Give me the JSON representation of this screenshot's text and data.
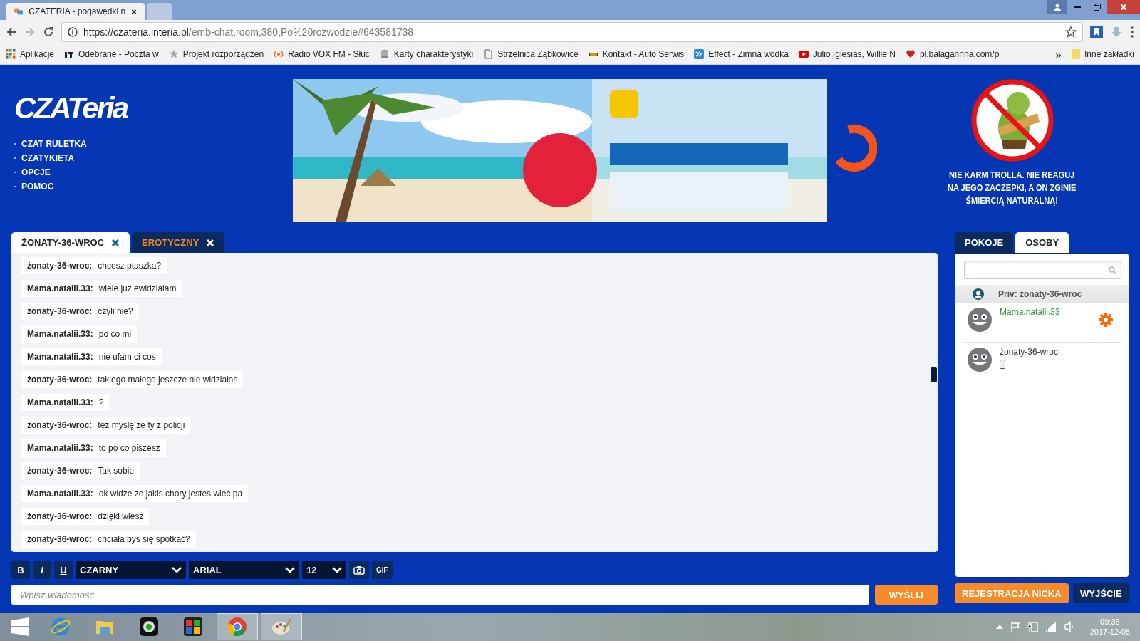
{
  "browser": {
    "tabs": [
      {
        "title": "CZATERIA - pogawędki n",
        "selected": true,
        "kind": "page"
      },
      {
        "selected": false,
        "kind": "new"
      }
    ],
    "url_host": "https://czateria.interia.pl",
    "url_path": "/emb-chat,room,380,Po%20rozwodzie#643581738",
    "bookmarks": [
      {
        "label": "Aplikacje",
        "kind": "apps"
      },
      {
        "label": "Odebrane - Poczta w",
        "kind": "int"
      },
      {
        "label": "Projekt rozporządzen",
        "kind": "eagle"
      },
      {
        "label": "Radio VOX FM - Słuc",
        "kind": "radio"
      },
      {
        "label": "Karty charakterystyki",
        "kind": "db"
      },
      {
        "label": "Strzelnica Ząbkowice",
        "kind": "doc"
      },
      {
        "label": "Kontakt - Auto Serwis",
        "kind": "car"
      },
      {
        "label": "Effect - Zimna wódka",
        "kind": "arrows"
      },
      {
        "label": "Julio Iglesias, Willie N",
        "kind": "video"
      },
      {
        "label": "pl.balagannna.com/p",
        "kind": "heart"
      }
    ],
    "more": "»",
    "other_bookmarks": "Inne zakładki"
  },
  "site": {
    "logo": "CZATeria",
    "nav": [
      "CZAT RULETKA",
      "CZATYKIETA",
      "OPCJE",
      "POMOC"
    ],
    "banner": {
      "kind": "picture"
    },
    "troll_notice": [
      "NIE KARM TROLLA. NIE REAGUJ",
      "NA JEGO ZACZEPKI, A ON ZGINIE",
      "ŚMIERCIĄ NATURALNĄ!"
    ],
    "chat_tabs": [
      {
        "label": "ŻONATY-36-WROC",
        "selected": true
      },
      {
        "label": "EROTYCZNY",
        "selected": false
      }
    ],
    "messages": [
      {
        "author": "żonaty-36-wroc:",
        "text": "chcesz ptaszka?"
      },
      {
        "author": "Mama.natalii.33:",
        "text": "wiele juz ewidzialam"
      },
      {
        "author": "żonaty-36-wroc:",
        "text": "czyli nie?"
      },
      {
        "author": "Mama.natalii.33:",
        "text": "po co mi"
      },
      {
        "author": "Mama.natalii.33:",
        "text": "nie ufam ci cos"
      },
      {
        "author": "żonaty-36-wroc:",
        "text": "takiego małego jeszcze nie widziałas"
      },
      {
        "author": "Mama.natalii.33:",
        "text": "?"
      },
      {
        "author": "żonaty-36-wroc:",
        "text": "tez myślę że ty z policji"
      },
      {
        "author": "Mama.natalii.33:",
        "text": "to po co piszesz"
      },
      {
        "author": "żonaty-36-wroc:",
        "text": "Tak sobie"
      },
      {
        "author": "Mama.natalii.33:",
        "text": "ok widze ze jakis chory jestes wiec pa"
      },
      {
        "author": "żonaty-36-wroc:",
        "text": "dzięki wiesz"
      },
      {
        "author": "żonaty-36-wroc:",
        "text": "chciała byś się spotkać?"
      }
    ],
    "format": {
      "bold": "B",
      "italic": "I",
      "underline": "U",
      "text_color": "CZARNY",
      "font": "ARIAL",
      "size": "12",
      "gif": "GIF"
    },
    "message_placeholder": "Wpisz wiadomość",
    "send": "WYŚLIJ",
    "side_tabs": [
      {
        "label": "POKOJE",
        "selected": false
      },
      {
        "label": "OSOBY",
        "selected": true
      }
    ],
    "priv": "Priv: żonaty-36-wroc",
    "users": [
      {
        "name": "Mama.natalii.33",
        "color": "#2f9a3a",
        "kind": "settings"
      },
      {
        "name": "żonaty-36-wroc",
        "color": "#333333",
        "kind": "mobile"
      }
    ],
    "register": "REJESTRACJA NICKA",
    "exit": "WYJŚCIE"
  },
  "taskbar": {
    "apps": [
      {
        "kind": "ie",
        "selected": false
      },
      {
        "kind": "folder",
        "selected": false
      },
      {
        "kind": "webcam",
        "selected": false
      },
      {
        "kind": "puzzle",
        "selected": false
      },
      {
        "kind": "chrome",
        "selected": true
      },
      {
        "kind": "paint",
        "selected": true
      }
    ],
    "time": "09:35",
    "date": "2017-12-08"
  }
}
